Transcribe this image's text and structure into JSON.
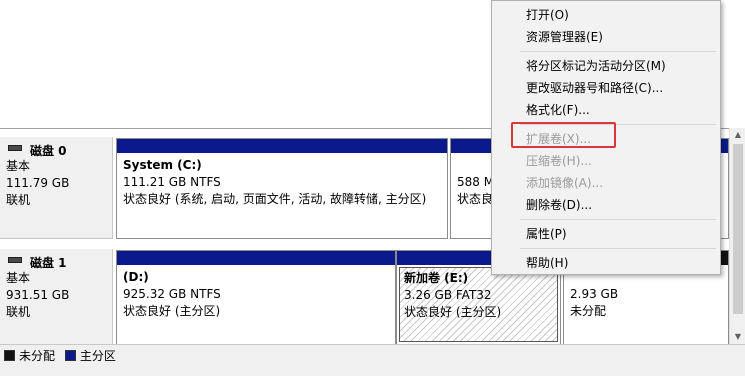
{
  "disks": [
    {
      "name": "磁盘 0",
      "type": "基本",
      "size": "111.79 GB",
      "status": "联机"
    },
    {
      "name": "磁盘 1",
      "type": "基本",
      "size": "931.51 GB",
      "status": "联机"
    }
  ],
  "partitions": {
    "system": {
      "title": "System  (C:)",
      "size": "111.21 GB NTFS",
      "status": "状态良好 (系统, 启动, 页面文件, 活动, 故障转储, 主分区)"
    },
    "recovery": {
      "size": "588 M",
      "status": "状态良"
    },
    "d": {
      "title": "(D:)",
      "size": "925.32 GB NTFS",
      "status": "状态良好 (主分区)"
    },
    "e": {
      "title": "新加卷  (E:)",
      "size": "3.26 GB FAT32",
      "status": "状态良好 (主分区)"
    },
    "unallocated": {
      "size": "2.93 GB",
      "status": "未分配"
    }
  },
  "legend": [
    {
      "label": "未分配",
      "color": "#111111"
    },
    {
      "label": "主分区",
      "color": "#0a1a8c"
    }
  ],
  "context_menu": {
    "items": [
      {
        "label": "打开(O)",
        "enabled": true
      },
      {
        "label": "资源管理器(E)",
        "enabled": true
      },
      {
        "label": "将分区标记为活动分区(M)",
        "enabled": true
      },
      {
        "label": "更改驱动器号和路径(C)...",
        "enabled": true
      },
      {
        "label": "格式化(F)...",
        "enabled": true
      },
      {
        "label": "扩展卷(X)...",
        "enabled": false
      },
      {
        "label": "压缩卷(H)...",
        "enabled": false
      },
      {
        "label": "添加镜像(A)...",
        "enabled": false
      },
      {
        "label": "删除卷(D)...",
        "enabled": true
      },
      {
        "label": "属性(P)",
        "enabled": true
      },
      {
        "label": "帮助(H)",
        "enabled": true
      }
    ],
    "highlighted_item": "扩展卷(X)...",
    "highlight_color": "#d9383a"
  },
  "colors": {
    "primary_partition": "#0a1a8c",
    "unallocated": "#111111"
  }
}
